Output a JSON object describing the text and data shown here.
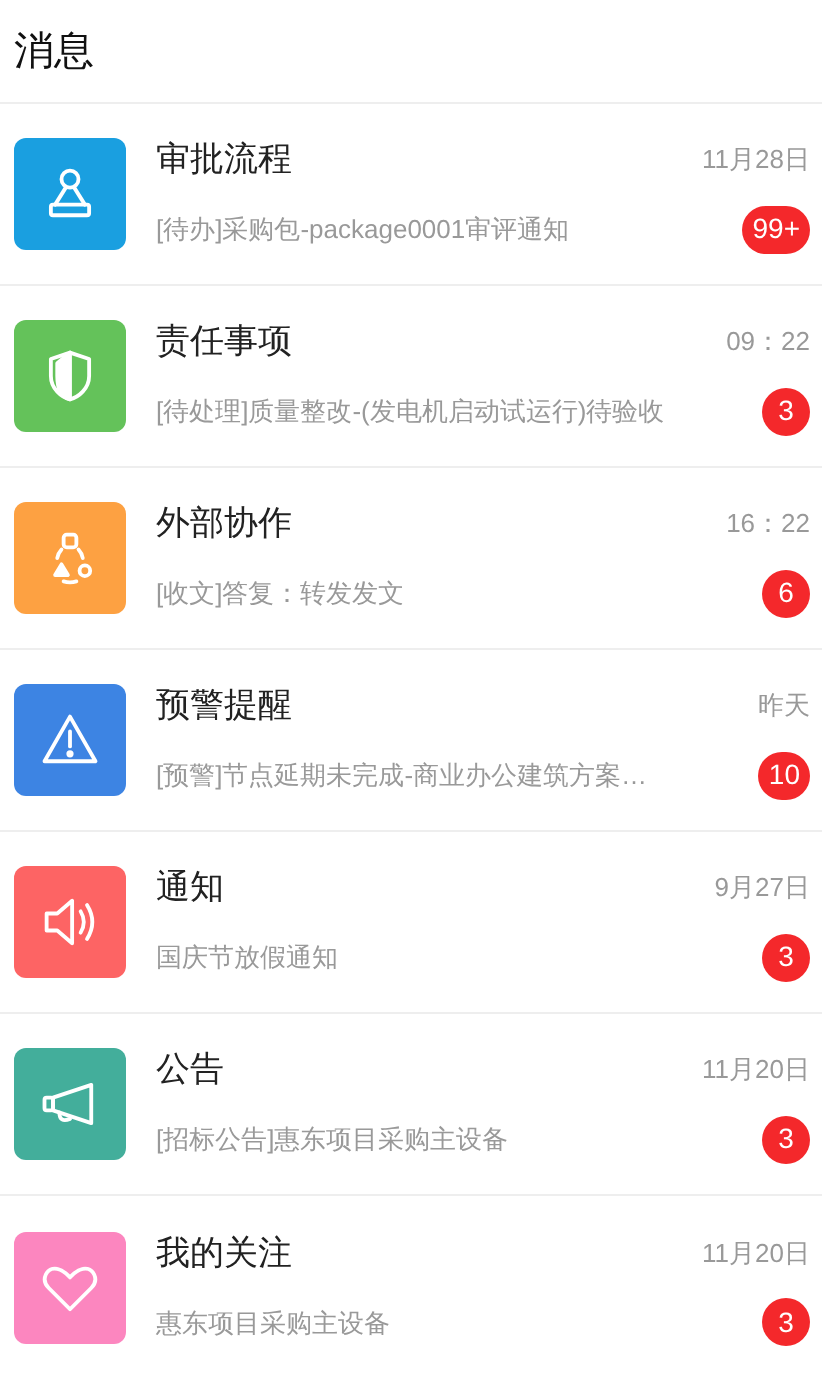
{
  "header": {
    "title": "消息"
  },
  "items": [
    {
      "kind": "stamp",
      "color": "#1a9fe0",
      "title": "审批流程",
      "subtitle": "[待办]采购包-package0001审评通知",
      "time": "11月28日",
      "badge": "99+"
    },
    {
      "kind": "shield",
      "color": "#64c25a",
      "title": "责任事项",
      "subtitle": "[待处理]质量整改-(发电机启动试运行)待验收",
      "time": "09：22",
      "badge": "3"
    },
    {
      "kind": "share",
      "color": "#fda142",
      "title": "外部协作",
      "subtitle": "[收文]答复：转发发文",
      "time": "16：22",
      "badge": "6"
    },
    {
      "kind": "warning",
      "color": "#3d84e3",
      "title": "预警提醒",
      "subtitle": "[预警]节点延期未完成-商业办公建筑方案…",
      "time": "昨天",
      "badge": "10"
    },
    {
      "kind": "speaker",
      "color": "#fd6464",
      "title": "通知",
      "subtitle": "国庆节放假通知",
      "time": "9月27日",
      "badge": "3"
    },
    {
      "kind": "megaphone",
      "color": "#43ae9b",
      "title": "公告",
      "subtitle": "[招标公告]惠东项目采购主设备",
      "time": "11月20日",
      "badge": "3"
    },
    {
      "kind": "heart",
      "color": "#fc86bf",
      "title": "我的关注",
      "subtitle": "惠东项目采购主设备",
      "time": "11月20日",
      "badge": "3"
    }
  ]
}
